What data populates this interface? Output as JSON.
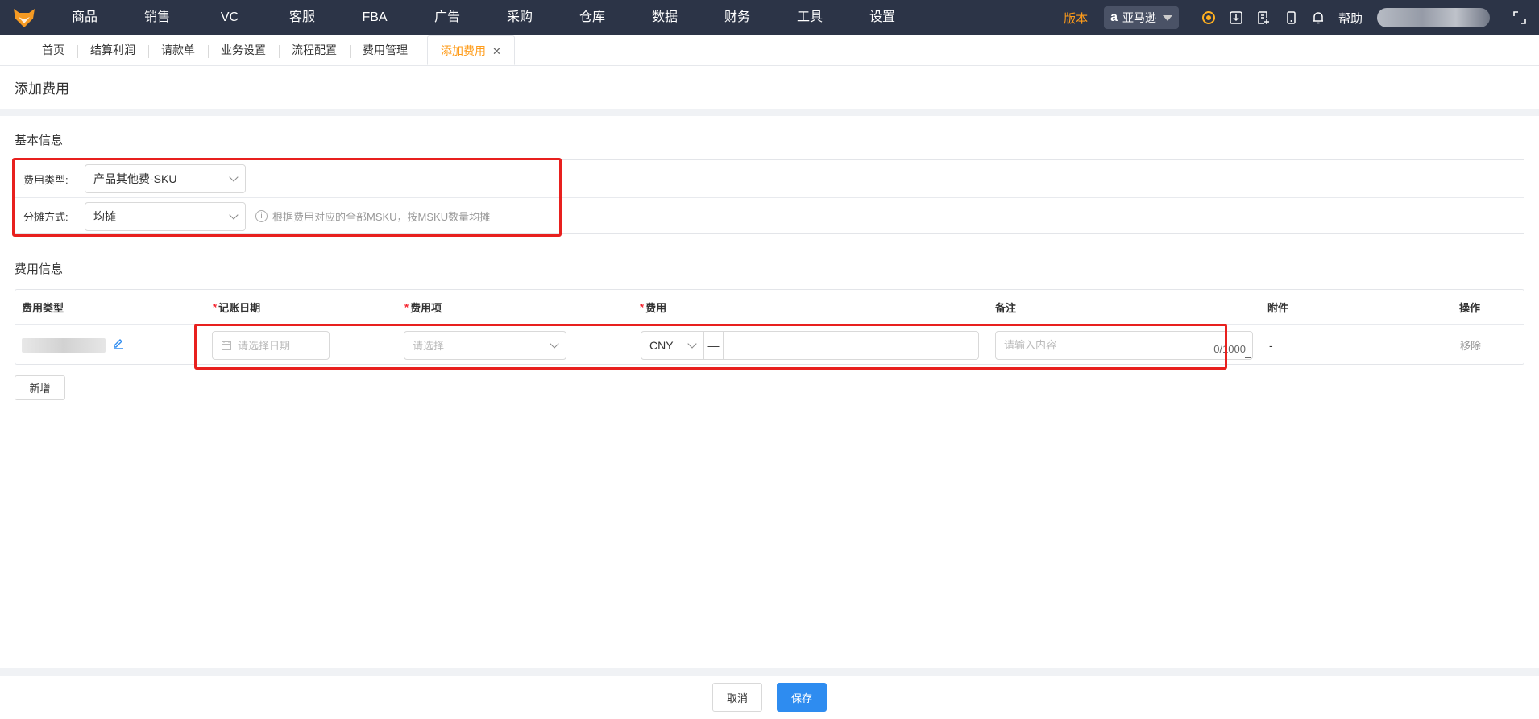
{
  "nav": {
    "items": [
      "商品",
      "销售",
      "VC",
      "客服",
      "FBA",
      "广告",
      "采购",
      "仓库",
      "数据",
      "财务",
      "工具",
      "设置"
    ],
    "version_label": "版本",
    "store_label": "亚马逊",
    "help_label": "帮助"
  },
  "tabs": [
    {
      "label": "首页"
    },
    {
      "label": "结算利润"
    },
    {
      "label": "请款单"
    },
    {
      "label": "业务设置"
    },
    {
      "label": "流程配置"
    },
    {
      "label": "费用管理"
    },
    {
      "label": "添加费用",
      "active": true
    }
  ],
  "page": {
    "title": "添加费用",
    "basic_section_title": "基本信息",
    "cost_section_title": "费用信息"
  },
  "basic": {
    "fee_type_label": "费用类型:",
    "fee_type_value": "产品其他费-SKU",
    "allocation_label": "分摊方式:",
    "allocation_value": "均摊",
    "allocation_hint": "根据费用对应的全部MSKU，按MSKU数量均摊"
  },
  "table": {
    "headers": {
      "fee_type": "费用类型",
      "date": "记账日期",
      "item": "费用项",
      "fee": "费用",
      "note": "备注",
      "attachment": "附件",
      "action": "操作"
    },
    "row": {
      "date_placeholder": "请选择日期",
      "item_placeholder": "请选择",
      "currency": "CNY",
      "dash": "—",
      "note_placeholder": "请输入内容",
      "note_count": "0/1000",
      "attachment": "-",
      "remove": "移除"
    }
  },
  "buttons": {
    "add": "新增",
    "cancel": "取消",
    "save": "保存"
  },
  "colors": {
    "nav_bg": "#2c3447",
    "accent": "#ff9c1a",
    "primary": "#2e8cf0",
    "highlight_box": "#e8201e"
  }
}
